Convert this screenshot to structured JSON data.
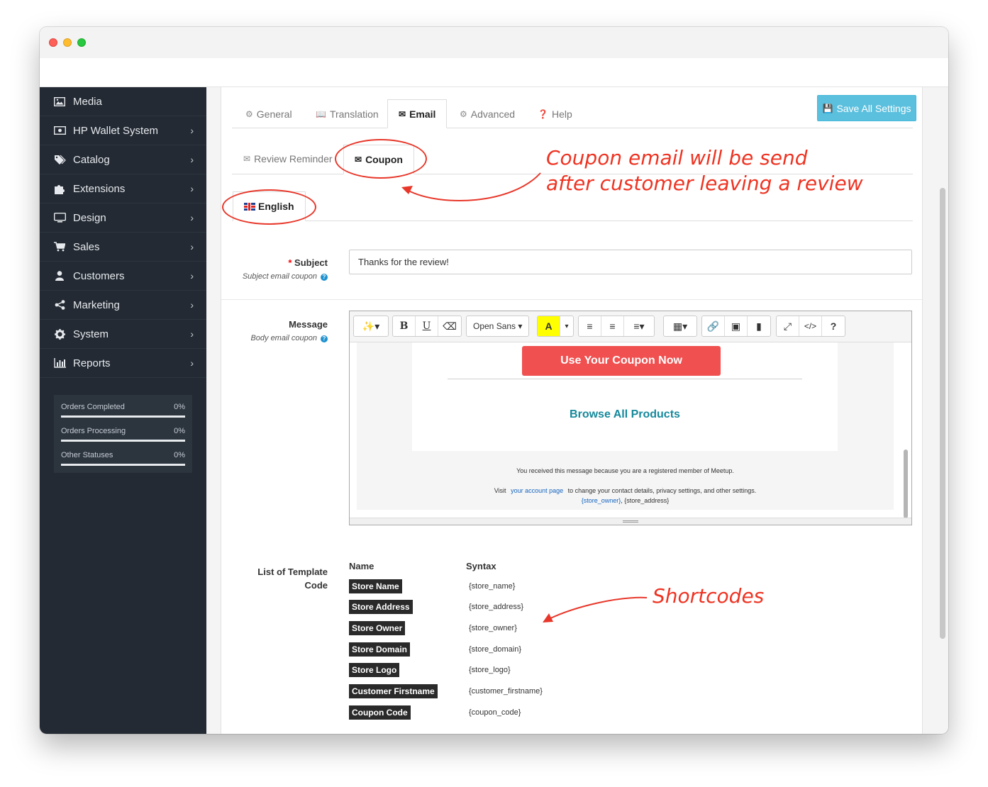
{
  "sidebar": {
    "items": [
      {
        "label": "Media",
        "icon": "image-icon",
        "chevron": false
      },
      {
        "label": "HP Wallet System",
        "icon": "wallet-icon",
        "chevron": true
      },
      {
        "label": "Catalog",
        "icon": "tags-icon",
        "chevron": true
      },
      {
        "label": "Extensions",
        "icon": "puzzle-icon",
        "chevron": true
      },
      {
        "label": "Design",
        "icon": "monitor-icon",
        "chevron": true
      },
      {
        "label": "Sales",
        "icon": "cart-icon",
        "chevron": true
      },
      {
        "label": "Customers",
        "icon": "user-icon",
        "chevron": true
      },
      {
        "label": "Marketing",
        "icon": "share-icon",
        "chevron": true
      },
      {
        "label": "System",
        "icon": "gear-icon",
        "chevron": true
      },
      {
        "label": "Reports",
        "icon": "bar-chart-icon",
        "chevron": true
      }
    ],
    "stats": [
      {
        "label": "Orders Completed",
        "value": "0%",
        "progress": 0
      },
      {
        "label": "Orders Processing",
        "value": "0%",
        "progress": 0
      },
      {
        "label": "Other Statuses",
        "value": "0%",
        "progress": 0
      }
    ]
  },
  "tabs": {
    "general": "General",
    "translation": "Translation",
    "email": "Email",
    "advanced": "Advanced",
    "help": "Help"
  },
  "save_button": "Save All Settings",
  "subtabs": {
    "review_reminder": "Review Reminder",
    "coupon": "Coupon"
  },
  "language_tab": "English",
  "annotations": {
    "coupon_line1": "Coupon email will be send",
    "coupon_line2": "after customer leaving a review",
    "shortcodes": "Shortcodes"
  },
  "subject": {
    "label": "Subject",
    "help": "Subject email coupon",
    "value": "Thanks for the review!"
  },
  "message": {
    "label": "Message",
    "help": "Body email coupon",
    "font_select": "Open Sans",
    "coupon_button": "Use Your Coupon Now",
    "browse_link": "Browse All Products",
    "footer_line1": "You received this message because you are a registered member of Meetup.",
    "footer_visit": "Visit",
    "footer_link": "your account page",
    "footer_rest": "to change your contact details, privacy settings, and other settings.",
    "footer_owner": "{store_owner}",
    "footer_address": ", {store_address}"
  },
  "template": {
    "label_line1": "List of Template",
    "label_line2": "Code",
    "col_name": "Name",
    "col_syntax": "Syntax",
    "rows": [
      {
        "name": "Store Name",
        "syntax": "{store_name}"
      },
      {
        "name": "Store Address",
        "syntax": "{store_address}"
      },
      {
        "name": "Store Owner",
        "syntax": "{store_owner}"
      },
      {
        "name": "Store Domain",
        "syntax": "{store_domain}"
      },
      {
        "name": "Store Logo",
        "syntax": "{store_logo}"
      },
      {
        "name": "Customer Firstname",
        "syntax": "{customer_firstname}"
      },
      {
        "name": "Coupon Code",
        "syntax": "{coupon_code}"
      }
    ]
  },
  "colors": {
    "sidebar_bg": "#232a33",
    "save_button": "#5bc0de",
    "coupon_button": "#f05050",
    "annotation": "#ee3322",
    "browse_link": "#15899b"
  }
}
